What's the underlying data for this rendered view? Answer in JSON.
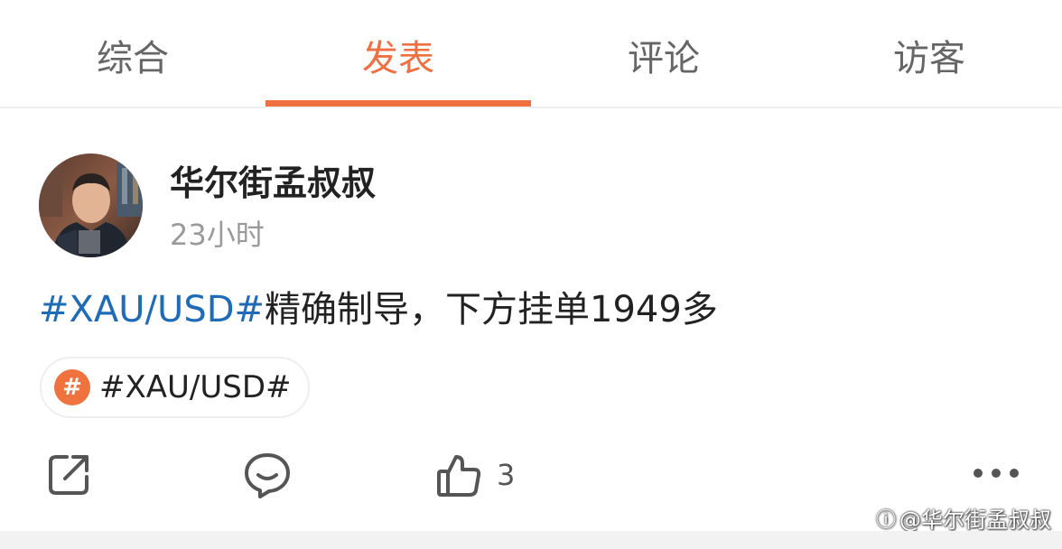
{
  "tabs": [
    {
      "label": "综合",
      "active": false
    },
    {
      "label": "发表",
      "active": true
    },
    {
      "label": "评论",
      "active": false
    },
    {
      "label": "访客",
      "active": false
    }
  ],
  "post": {
    "author": "华尔街孟叔叔",
    "time": "23小时",
    "hashtag": "#XAU/USD#",
    "text": "精确制导，下方挂单1949多",
    "topic_badge": "#",
    "topic": "#XAU/USD#"
  },
  "actions": {
    "share_icon": "share-icon",
    "comment_icon": "comment-icon",
    "like_icon": "thumbs-up-icon",
    "like_count": "3",
    "more_icon": "more-icon"
  },
  "watermark": {
    "logo": "ⓘ",
    "text": "@华尔街孟叔叔"
  },
  "colors": {
    "accent": "#ef6f41",
    "hashtag": "#1e6bb8",
    "muted": "#9a9a9a"
  }
}
